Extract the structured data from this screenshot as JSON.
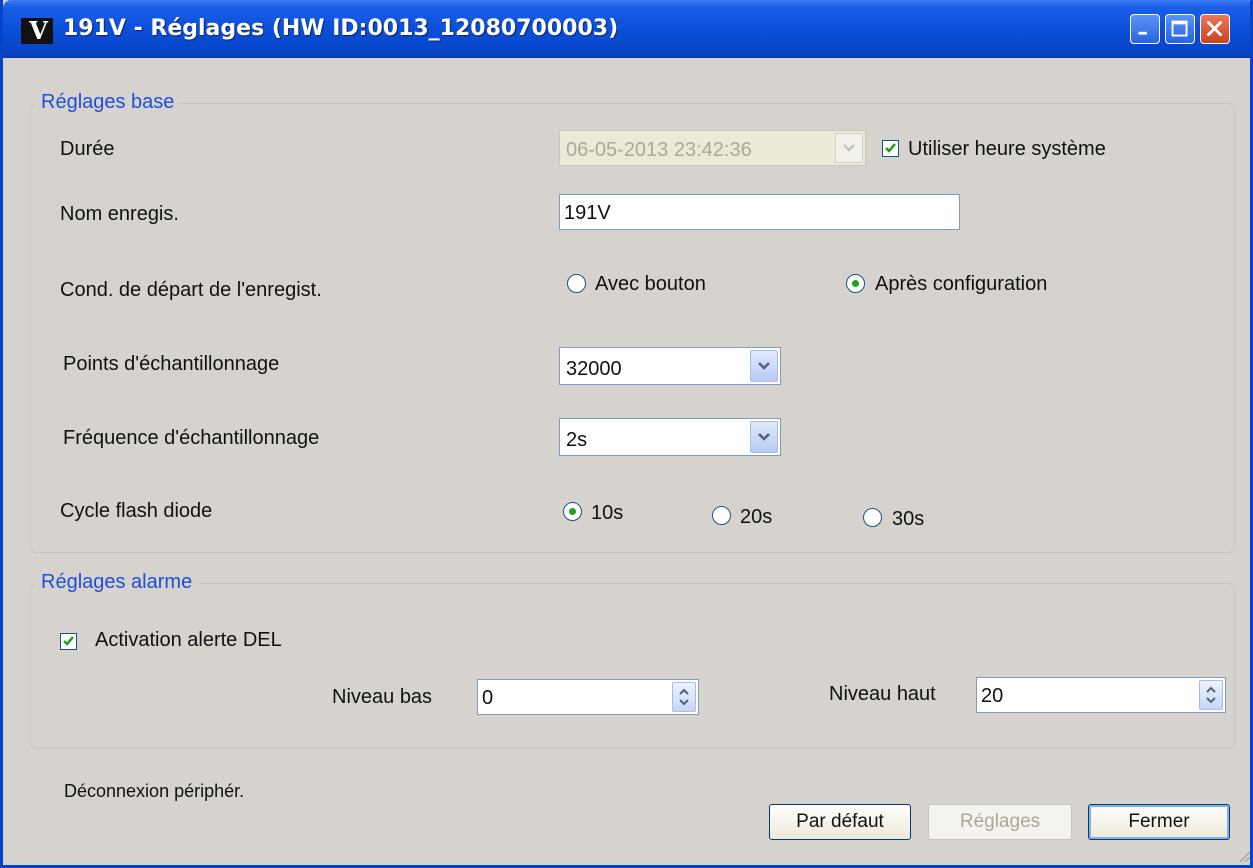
{
  "window": {
    "title": "191V - Réglages (HW ID:0013_12080700003)",
    "app_icon_glyph": "V",
    "controls": [
      "minimize-icon",
      "maximize-icon",
      "close-icon"
    ]
  },
  "base": {
    "legend": "Réglages base",
    "duration": {
      "label": "Durée",
      "value": "06-05-2013 23:42:36",
      "enabled": false
    },
    "use_system_time": {
      "label": "Utiliser heure système",
      "checked": true
    },
    "record_name": {
      "label": "Nom enregis.",
      "value": "191V"
    },
    "start_condition": {
      "label": "Cond. de départ de l'enregist.",
      "options": [
        "Avec bouton",
        "Après configuration"
      ],
      "selected": "Après configuration"
    },
    "sample_points": {
      "label": "Points d'échantillonnage",
      "value": "32000"
    },
    "sample_rate": {
      "label": "Fréquence d'échantillonnage",
      "value": "2s"
    },
    "led_flash": {
      "label": "Cycle flash diode",
      "options": [
        "10s",
        "20s",
        "30s"
      ],
      "selected": "10s"
    }
  },
  "alarm": {
    "legend": "Réglages alarme",
    "led_alert": {
      "label": "Activation alerte DEL",
      "checked": true
    },
    "low": {
      "label": "Niveau bas",
      "value": "0"
    },
    "high": {
      "label": "Niveau haut",
      "value": "20"
    }
  },
  "footer": {
    "status": "Déconnexion périphér.",
    "defaults_button": "Par défaut",
    "apply_button": "Réglages",
    "close_button": "Fermer"
  },
  "colors": {
    "title_bar": "#0b4fd8",
    "legend_text": "#1f4fd8",
    "window_bg": "#d6d3ce",
    "check_green": "#21a121"
  }
}
